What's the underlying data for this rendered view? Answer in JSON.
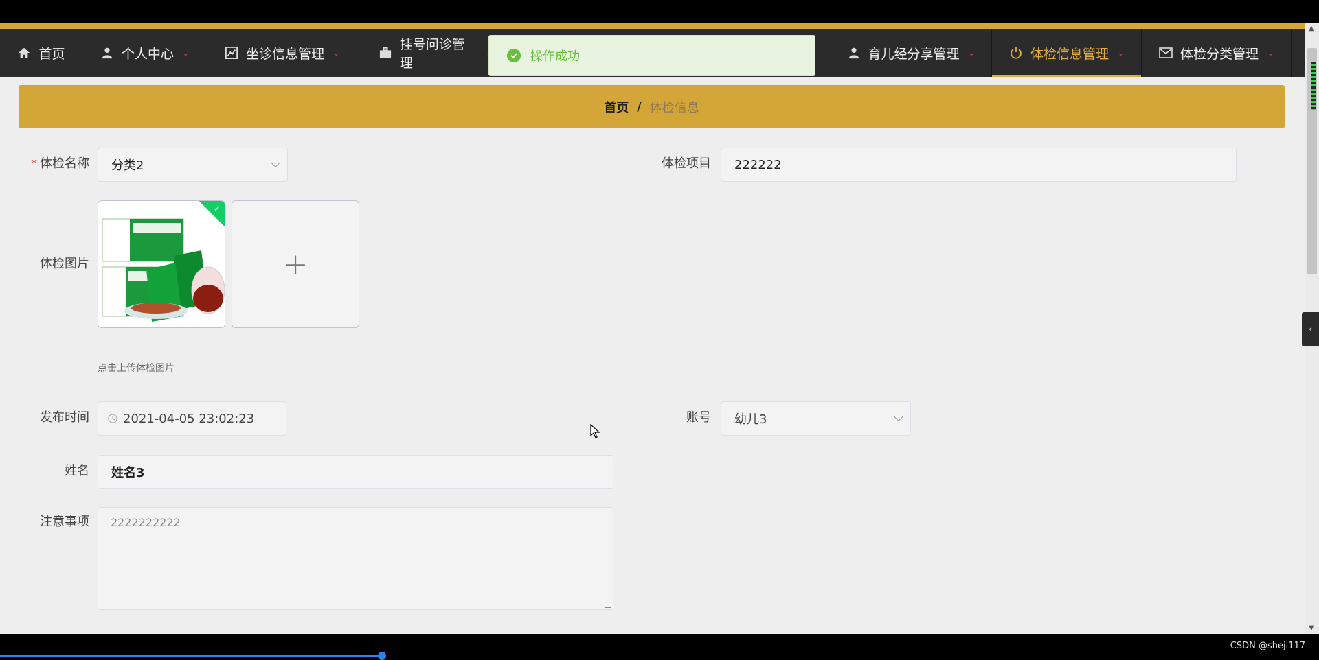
{
  "nav": {
    "items": [
      {
        "label": "首页",
        "icon": "home-icon"
      },
      {
        "label": "个人中心",
        "icon": "user-icon"
      },
      {
        "label": "坐诊信息管理",
        "icon": "chart-icon"
      },
      {
        "label": "挂号问诊管理",
        "icon": "briefcase-icon"
      },
      {
        "label": "育儿经分享管理",
        "icon": "user-icon"
      },
      {
        "label": "体检信息管理",
        "icon": "power-icon",
        "active": true
      },
      {
        "label": "体检分类管理",
        "icon": "mail-icon"
      }
    ]
  },
  "toast": {
    "message": "操作成功"
  },
  "breadcrumb": {
    "home": "首页",
    "separator": "/",
    "current": "体检信息"
  },
  "form": {
    "name": {
      "label": "体检名称",
      "value": "分类2",
      "required": true
    },
    "project": {
      "label": "体检项目",
      "value": "222222"
    },
    "image": {
      "label": "体检图片",
      "tip": "点击上传体检图片",
      "upload_glyph": "+"
    },
    "publish_time": {
      "label": "发布时间",
      "value": "2021-04-05 23:02:23"
    },
    "account": {
      "label": "账号",
      "value": "幼儿3"
    },
    "person_name": {
      "label": "姓名",
      "value": "姓名3"
    },
    "notes": {
      "label": "注意事项",
      "value": "2222222222"
    }
  },
  "footer": {
    "watermark": "CSDN @sheji117"
  },
  "colors": {
    "accent": "#d4a537",
    "nav_bg": "#2b2b2b",
    "active": "#e2ac3a",
    "success": "#67c23a",
    "caret": "#c9434b"
  }
}
